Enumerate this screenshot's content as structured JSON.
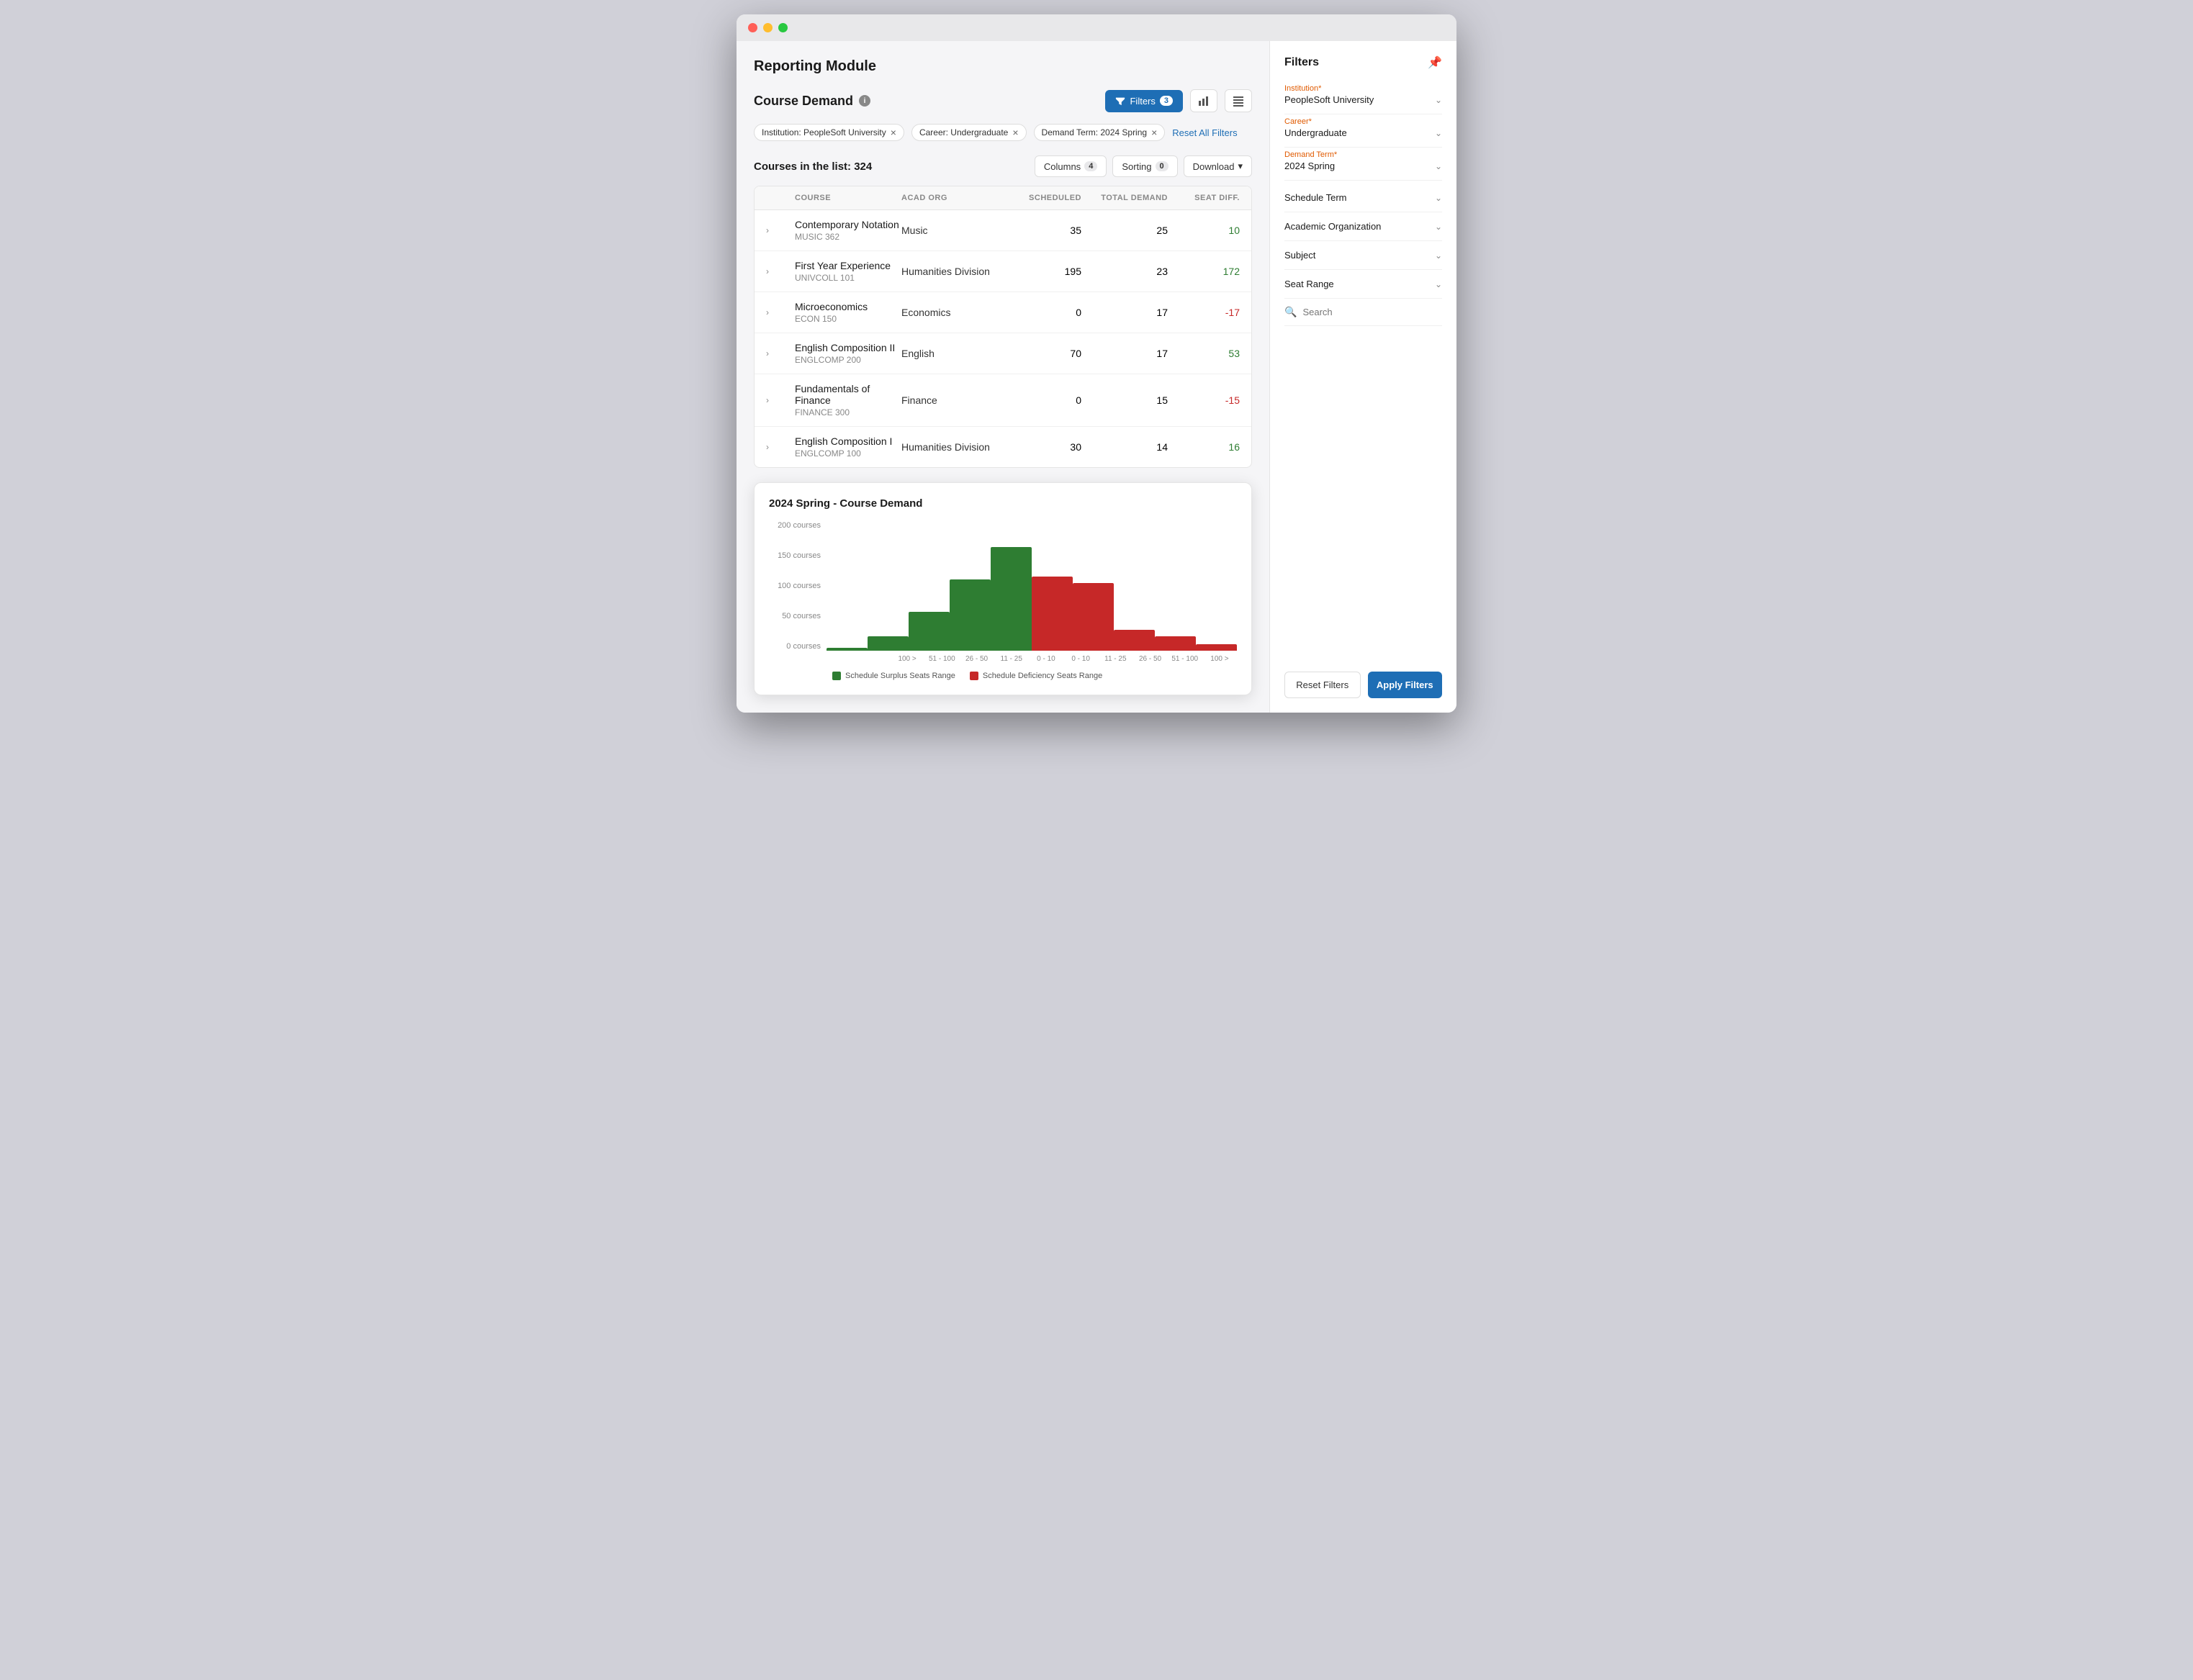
{
  "window": {
    "title": "Reporting Module"
  },
  "page": {
    "title": "Reporting Module",
    "section_title": "Course Demand",
    "list_count": "Courses in the list: 324"
  },
  "header_actions": {
    "filters_label": "Filters",
    "filters_count": "3",
    "columns_label": "Columns",
    "columns_count": "4",
    "sorting_label": "Sorting",
    "sorting_count": "0",
    "download_label": "Download"
  },
  "active_filters": [
    {
      "label": "Institution: PeopleSoft University",
      "id": "institution-filter"
    },
    {
      "label": "Career: Undergraduate",
      "id": "career-filter"
    },
    {
      "label": "Demand Term: 2024 Spring",
      "id": "term-filter"
    }
  ],
  "reset_filters_label": "Reset All Filters",
  "table": {
    "columns": [
      "",
      "COURSE",
      "ACAD ORG",
      "SCHEDULED",
      "TOTAL DEMAND",
      "SEAT DIFF."
    ],
    "rows": [
      {
        "course_name": "Contemporary Notation",
        "course_code": "MUSIC 362",
        "acad_org": "Music",
        "scheduled": "35",
        "total_demand": "25",
        "seat_diff": "10",
        "diff_type": "positive"
      },
      {
        "course_name": "First Year Experience",
        "course_code": "UNIVCOLL 101",
        "acad_org": "Humanities Division",
        "scheduled": "195",
        "total_demand": "23",
        "seat_diff": "172",
        "diff_type": "positive"
      },
      {
        "course_name": "Microeconomics",
        "course_code": "ECON 150",
        "acad_org": "Economics",
        "scheduled": "0",
        "total_demand": "17",
        "seat_diff": "-17",
        "diff_type": "negative"
      },
      {
        "course_name": "English Composition II",
        "course_code": "ENGLCOMP 200",
        "acad_org": "English",
        "scheduled": "70",
        "total_demand": "17",
        "seat_diff": "53",
        "diff_type": "positive"
      },
      {
        "course_name": "Fundamentals of Finance",
        "course_code": "FINANCE 300",
        "acad_org": "Finance",
        "scheduled": "0",
        "total_demand": "15",
        "seat_diff": "-15",
        "diff_type": "negative"
      },
      {
        "course_name": "English Composition I",
        "course_code": "ENGLCOMP 100",
        "acad_org": "Humanities Division",
        "scheduled": "30",
        "total_demand": "14",
        "seat_diff": "16",
        "diff_type": "positive"
      }
    ]
  },
  "chart": {
    "title": "2024 Spring - Course Demand",
    "y_labels": [
      "200 courses",
      "150 courses",
      "100 courses",
      "50 courses",
      "0 courses"
    ],
    "x_labels": [
      "100 >",
      "51 - 100",
      "26 - 50",
      "11 - 25",
      "0 - 10",
      "0 - 10",
      "11 - 25",
      "26 - 50",
      "51 - 100",
      "100 >"
    ],
    "bars": [
      {
        "green": 5,
        "red": 0
      },
      {
        "green": 22,
        "red": 0
      },
      {
        "green": 60,
        "red": 0
      },
      {
        "green": 110,
        "red": 0
      },
      {
        "green": 160,
        "red": 0
      },
      {
        "green": 0,
        "red": 115
      },
      {
        "green": 0,
        "red": 105
      },
      {
        "green": 0,
        "red": 32
      },
      {
        "green": 0,
        "red": 22
      },
      {
        "green": 0,
        "red": 10
      }
    ],
    "max_value": 200,
    "legend": [
      {
        "label": "Schedule Surplus Seats Range",
        "color": "#2e7d32"
      },
      {
        "label": "Schedule Deficiency Seats Range",
        "color": "#c62828"
      }
    ]
  },
  "filters_panel": {
    "title": "Filters",
    "institution_label": "Institution*",
    "institution_value": "PeopleSoft University",
    "career_label": "Career*",
    "career_value": "Undergraduate",
    "demand_term_label": "Demand Term*",
    "demand_term_value": "2024 Spring",
    "schedule_term_label": "Schedule Term",
    "academic_org_label": "Academic Organization",
    "subject_label": "Subject",
    "seat_range_label": "Seat Range",
    "search_placeholder": "Search",
    "reset_label": "Reset Filters",
    "apply_label": "Apply Filters"
  },
  "colors": {
    "primary": "#1e6eb5",
    "positive": "#2e7d32",
    "negative": "#c62828",
    "required": "#e05a00"
  }
}
